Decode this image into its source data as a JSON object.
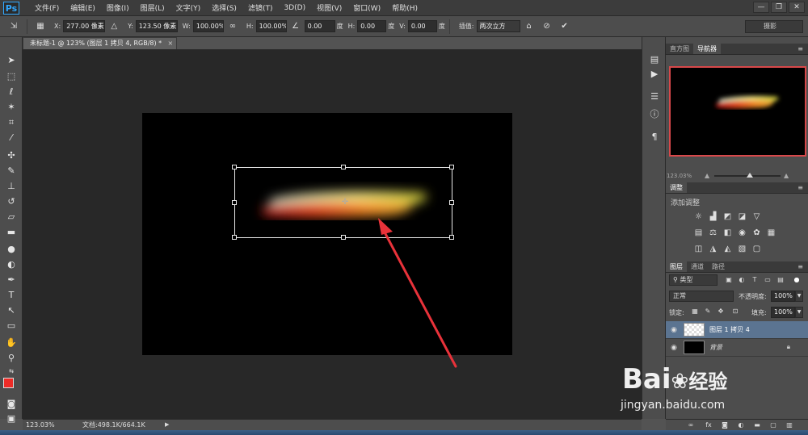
{
  "app": {
    "logo": "Ps",
    "menu": [
      "文件(F)",
      "编辑(E)",
      "图像(I)",
      "图层(L)",
      "文字(Y)",
      "选择(S)",
      "滤镜(T)",
      "3D(D)",
      "视图(V)",
      "窗口(W)",
      "帮助(H)"
    ],
    "window_controls": [
      "—",
      "❐",
      "✕"
    ]
  },
  "options": {
    "x_label": "X:",
    "x_value": "277.00 像素",
    "y_label": "Y:",
    "y_value": "123.50 像素",
    "w_label": "W:",
    "w_value": "100.00%",
    "h_label": "H:",
    "h_value": "100.00%",
    "angle_value": "0.00",
    "angle_unit": "度",
    "hskew_label": "H:",
    "hskew_value": "0.00",
    "hskew_unit": "度",
    "vskew_label": "V:",
    "vskew_value": "0.00",
    "vskew_unit": "度",
    "interp_label": "插值:",
    "interp_value": "两次立方",
    "workspace": "摄影"
  },
  "document": {
    "tab_title": "未标题-1 @ 123% (图层 1 拷贝 4, RGB/8) *",
    "tab_close": "×"
  },
  "status": {
    "zoom": "123.03%",
    "doc_info": "文档:498.1K/664.1K"
  },
  "navigator": {
    "tabs": [
      "直方图",
      "导航器"
    ],
    "active_tab": "导航器",
    "zoom": "123.03%"
  },
  "adjustments": {
    "tab": "调整",
    "label": "添加调整"
  },
  "layers": {
    "tabs": [
      "图层",
      "通道",
      "路径"
    ],
    "active_tab": "图层",
    "filter": "类型",
    "blend_mode": "正常",
    "opacity_label": "不透明度:",
    "opacity": "100%",
    "lock_label": "锁定:",
    "fill_label": "填充:",
    "fill": "100%",
    "items": [
      {
        "name": "图层 1 拷贝 4",
        "selected": true
      },
      {
        "name": "背景",
        "selected": false,
        "locked": true
      }
    ]
  },
  "colors": {
    "foreground": "#ee2c27",
    "background": "#000000",
    "selected_layer": "#5b7491",
    "annotation_arrow": "#e8323a",
    "navigator_frame": "#d8484a"
  },
  "watermark": {
    "brand": "Bai",
    "brand_suffix": "经验",
    "url": "jingyan.baidu.com"
  }
}
